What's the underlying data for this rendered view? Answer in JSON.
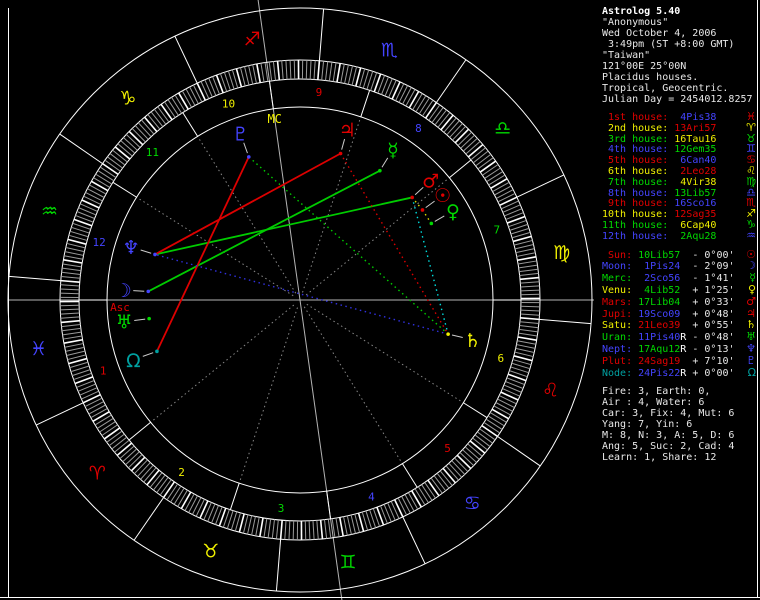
{
  "app_title": "Astrolog 5.40",
  "header": {
    "lines": [
      "Astrolog 5.40",
      "\"Anonymous\"",
      "Wed October 4, 2006",
      " 3:49pm (ST +8:00 GMT)",
      "\"Taiwan\"",
      "121°00E 25°00N",
      "Placidus houses.",
      "Tropical, Geocentric.",
      "Julian Day = 2454012.8257"
    ]
  },
  "palette": {
    "red": "#e00000",
    "yellow": "#f0f000",
    "green": "#00d800",
    "blue": "#4444ff",
    "teal": "#00a0a0",
    "cyan": "#00dddd",
    "white": "#ffffff",
    "gray_axis": "#b4b4b4",
    "gray_dotted": "#878787",
    "gray_pointer": "#cccccc",
    "background": "#000000"
  },
  "houses": {
    "rows": [
      {
        "label": " 1st house:",
        "value": " 4Pis38",
        "glyph": "♓",
        "label_color": "#e00000",
        "value_color": "#4444ff",
        "glyph_color": "#e00000"
      },
      {
        "label": " 2nd house:",
        "value": "13Ari57",
        "glyph": "♈",
        "label_color": "#f0f000",
        "value_color": "#e00000",
        "glyph_color": "#f0f000"
      },
      {
        "label": " 3rd house:",
        "value": "16Tau16",
        "glyph": "♉",
        "label_color": "#00d800",
        "value_color": "#f0f000",
        "glyph_color": "#00d800"
      },
      {
        "label": " 4th house:",
        "value": "12Gem35",
        "glyph": "♊",
        "label_color": "#4444ff",
        "value_color": "#00d800",
        "glyph_color": "#4444ff"
      },
      {
        "label": " 5th house:",
        "value": " 6Can40",
        "glyph": "♋",
        "label_color": "#e00000",
        "value_color": "#4444ff",
        "glyph_color": "#e00000"
      },
      {
        "label": " 6th house:",
        "value": " 2Leo28",
        "glyph": "♌",
        "label_color": "#f0f000",
        "value_color": "#e00000",
        "glyph_color": "#f0f000"
      },
      {
        "label": " 7th house:",
        "value": " 4Vir38",
        "glyph": "♍",
        "label_color": "#00d800",
        "value_color": "#f0f000",
        "glyph_color": "#00d800"
      },
      {
        "label": " 8th house:",
        "value": "13Lib57",
        "glyph": "♎",
        "label_color": "#4444ff",
        "value_color": "#00d800",
        "glyph_color": "#4444ff"
      },
      {
        "label": " 9th house:",
        "value": "16Sco16",
        "glyph": "♏",
        "label_color": "#e00000",
        "value_color": "#4444ff",
        "glyph_color": "#e00000"
      },
      {
        "label": "10th house:",
        "value": "12Sag35",
        "glyph": "♐",
        "label_color": "#f0f000",
        "value_color": "#e00000",
        "glyph_color": "#f0f000"
      },
      {
        "label": "11th house:",
        "value": " 6Cap40",
        "glyph": "♑",
        "label_color": "#00d800",
        "value_color": "#f0f000",
        "glyph_color": "#00d800"
      },
      {
        "label": "12th house:",
        "value": " 2Aqu28",
        "glyph": "♒",
        "label_color": "#4444ff",
        "value_color": "#00d800",
        "glyph_color": "#4444ff"
      }
    ]
  },
  "planets": {
    "rows": [
      {
        "label": " Sun:",
        "value": "10Lib57",
        "retro": " ",
        "motion": "- 0°00'",
        "glyph": "☉",
        "label_color": "#e00000",
        "value_color": "#00d800",
        "glyph_color": "#e00000"
      },
      {
        "label": "Moon:",
        "value": " 1Pis24",
        "retro": " ",
        "motion": "- 2°09'",
        "glyph": "☽",
        "label_color": "#4444ff",
        "value_color": "#4444ff",
        "glyph_color": "#4444ff"
      },
      {
        "label": "Merc:",
        "value": " 2Sco56",
        "retro": " ",
        "motion": "- 1°41'",
        "glyph": "☿",
        "label_color": "#00d800",
        "value_color": "#4444ff",
        "glyph_color": "#00d800"
      },
      {
        "label": "Venu:",
        "value": " 4Lib52",
        "retro": " ",
        "motion": "+ 1°25'",
        "glyph": "♀",
        "label_color": "#f0f000",
        "value_color": "#00d800",
        "glyph_color": "#f0f000"
      },
      {
        "label": "Mars:",
        "value": "17Lib04",
        "retro": " ",
        "motion": "+ 0°33'",
        "glyph": "♂",
        "label_color": "#e00000",
        "value_color": "#00d800",
        "glyph_color": "#e00000"
      },
      {
        "label": "Jupi:",
        "value": "19Sco09",
        "retro": " ",
        "motion": "+ 0°48'",
        "glyph": "♃",
        "label_color": "#e00000",
        "value_color": "#4444ff",
        "glyph_color": "#e00000"
      },
      {
        "label": "Satu:",
        "value": "21Leo39",
        "retro": " ",
        "motion": "+ 0°55'",
        "glyph": "♄",
        "label_color": "#f0f000",
        "value_color": "#e00000",
        "glyph_color": "#f0f000"
      },
      {
        "label": "Uran:",
        "value": "11Pis40",
        "retro": "R",
        "motion": "- 0°48'",
        "glyph": "♅",
        "label_color": "#00d800",
        "value_color": "#4444ff",
        "glyph_color": "#00d800"
      },
      {
        "label": "Nept:",
        "value": "17Aqu12",
        "retro": "R",
        "motion": "- 0°13'",
        "glyph": "♆",
        "label_color": "#4444ff",
        "value_color": "#00d800",
        "glyph_color": "#4444ff"
      },
      {
        "label": "Plut:",
        "value": "24Sag19",
        "retro": " ",
        "motion": "+ 7°10'",
        "glyph": "♇",
        "label_color": "#e00000",
        "value_color": "#e00000",
        "glyph_color": "#4444ff"
      },
      {
        "label": "Node:",
        "value": "24Pis22",
        "retro": "R",
        "motion": "+ 0°00'",
        "glyph": "Ω",
        "label_color": "#00a0a0",
        "value_color": "#4444ff",
        "glyph_color": "#00a0a0"
      }
    ]
  },
  "stats": {
    "lines": [
      "Fire: 3, Earth: 0,",
      "Air : 4, Water: 6",
      "Car: 3, Fix: 4, Mut: 6",
      "Yang: 7, Yin: 6",
      "M: 8, N: 3, A: 5, D: 6",
      "Ang: 5, Suc: 2, Cad: 4",
      "Learn: 1, Share: 12"
    ]
  },
  "chart_data": {
    "type": "astrology-wheel",
    "title": "Astrolog 5.40 natal wheel",
    "ascendant_deg": 334.633,
    "midheaven_deg": 252.583,
    "house_cusps_deg": [
      334.633,
      13.95,
      46.267,
      72.583,
      96.667,
      122.467,
      154.633,
      193.95,
      226.267,
      252.583,
      276.667,
      302.467
    ],
    "house_numbers": [
      "1",
      "2",
      "3",
      "4",
      "5",
      "6",
      "7",
      "8",
      "9",
      "10",
      "11",
      "12"
    ],
    "house_number_colors": [
      "#e00000",
      "#f0f000",
      "#00d800",
      "#4444ff"
    ],
    "signs": [
      {
        "name": "Aries",
        "glyph": "♈",
        "color": "#e00000"
      },
      {
        "name": "Taurus",
        "glyph": "♉",
        "color": "#f0f000"
      },
      {
        "name": "Gemini",
        "glyph": "♊",
        "color": "#00d800"
      },
      {
        "name": "Cancer",
        "glyph": "♋",
        "color": "#4444ff"
      },
      {
        "name": "Leo",
        "glyph": "♌",
        "color": "#e00000"
      },
      {
        "name": "Virgo",
        "glyph": "♍",
        "color": "#f0f000"
      },
      {
        "name": "Libra",
        "glyph": "♎",
        "color": "#00d800"
      },
      {
        "name": "Scorpio",
        "glyph": "♏",
        "color": "#4444ff"
      },
      {
        "name": "Sagittarius",
        "glyph": "♐",
        "color": "#e00000"
      },
      {
        "name": "Capricorn",
        "glyph": "♑",
        "color": "#f0f000"
      },
      {
        "name": "Aquarius",
        "glyph": "♒",
        "color": "#00d800"
      },
      {
        "name": "Pisces",
        "glyph": "♓",
        "color": "#4444ff"
      }
    ],
    "planets": [
      {
        "name": "Sun",
        "glyph": "☉",
        "lon_deg": 190.95,
        "color": "#e00000"
      },
      {
        "name": "Moon",
        "glyph": "☽",
        "lon_deg": 331.4,
        "color": "#4444ff"
      },
      {
        "name": "Mercury",
        "glyph": "☿",
        "lon_deg": 212.933,
        "color": "#00d800"
      },
      {
        "name": "Venus",
        "glyph": "♀",
        "lon_deg": 184.867,
        "color": "#00d800"
      },
      {
        "name": "Mars",
        "glyph": "♂",
        "lon_deg": 197.067,
        "color": "#e00000"
      },
      {
        "name": "Jupiter",
        "glyph": "♃",
        "lon_deg": 229.15,
        "color": "#e00000"
      },
      {
        "name": "Saturn",
        "glyph": "♄",
        "lon_deg": 141.65,
        "color": "#f0f000"
      },
      {
        "name": "Uranus",
        "glyph": "♅",
        "lon_deg": 341.667,
        "color": "#00d800"
      },
      {
        "name": "Neptune",
        "glyph": "♆",
        "lon_deg": 317.2,
        "color": "#4444ff"
      },
      {
        "name": "Pluto",
        "glyph": "♇",
        "lon_deg": 264.317,
        "color": "#4444ff"
      },
      {
        "name": "Node",
        "glyph": "Ω",
        "lon_deg": 354.367,
        "color": "#00a0a0"
      }
    ],
    "aspects": [
      {
        "a": "Moon",
        "b": "Mercury",
        "type": "trine",
        "style": "solid",
        "color": "#00cc00"
      },
      {
        "a": "Mars",
        "b": "Neptune",
        "type": "trine",
        "style": "solid",
        "color": "#00cc00"
      },
      {
        "a": "Saturn",
        "b": "Pluto",
        "type": "trine",
        "style": "dotted",
        "color": "#00cc00"
      },
      {
        "a": "Jupiter",
        "b": "Neptune",
        "type": "square",
        "style": "solid",
        "color": "#dd0000"
      },
      {
        "a": "Pluto",
        "b": "Node",
        "type": "square",
        "style": "solid",
        "color": "#dd0000"
      },
      {
        "a": "Jupiter",
        "b": "Saturn",
        "type": "square",
        "style": "dotted",
        "color": "#dd0000"
      },
      {
        "a": "Saturn",
        "b": "Neptune",
        "type": "opposition",
        "style": "dotted",
        "color": "#3030dd"
      },
      {
        "a": "Mars",
        "b": "Saturn",
        "type": "sextile",
        "style": "dotted",
        "color": "#00dddd"
      },
      {
        "a": "Sun",
        "b": "Venus",
        "type": "conjunction",
        "style": "dotted",
        "color": "#dddd00"
      },
      {
        "a": "Sun",
        "b": "Mars",
        "type": "conjunction",
        "style": "dotted",
        "color": "#dddd00"
      }
    ],
    "labels": {
      "asc": "Asc",
      "mc": "MC",
      "asc_color": "#e00000",
      "mc_color": "#f0f000"
    },
    "rings": {
      "outer": 292,
      "sign_inner": 240,
      "tick_inner": 221,
      "inner": 193
    },
    "legend_position": "right-panel",
    "grid": false
  }
}
